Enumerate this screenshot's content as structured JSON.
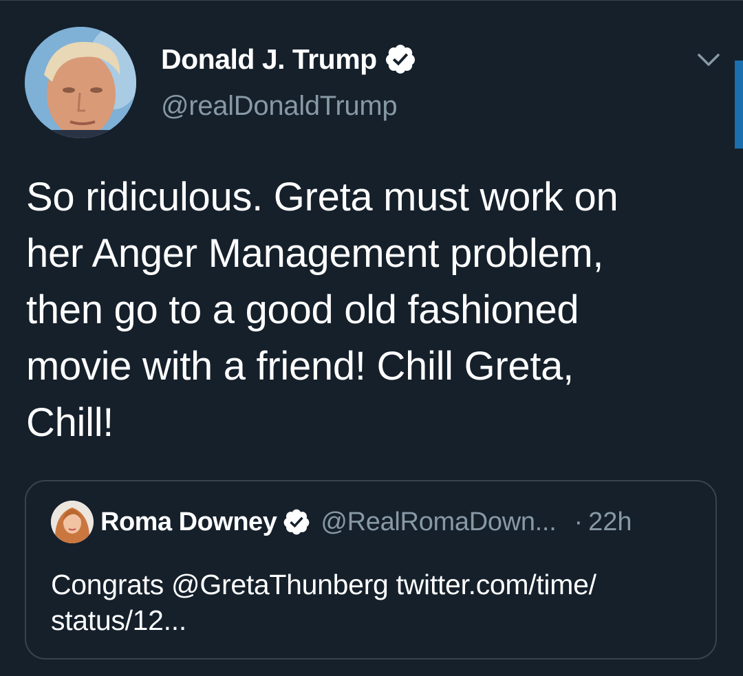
{
  "tweet": {
    "author_name": "Donald J. Trump",
    "author_handle": "@realDonaldTrump",
    "text": "So ridiculous. Greta must work on\nher Anger Management problem,\nthen go to a good old fashioned\nmovie with a friend! Chill Greta,\nChill!"
  },
  "quoted_tweet": {
    "author_name": "Roma Downey",
    "author_handle": "@RealRomaDown...",
    "separator": "·",
    "time": "22h",
    "text": "Congrats @GretaThunberg twitter.com/time/ status/12..."
  },
  "icons": {
    "verified": "verified-badge-icon",
    "menu": "chevron-down-icon"
  },
  "colors": {
    "background": "#15202b",
    "border": "#38444d",
    "secondary_text": "#8899a6",
    "scroll_indicator": "#1b6fae"
  }
}
